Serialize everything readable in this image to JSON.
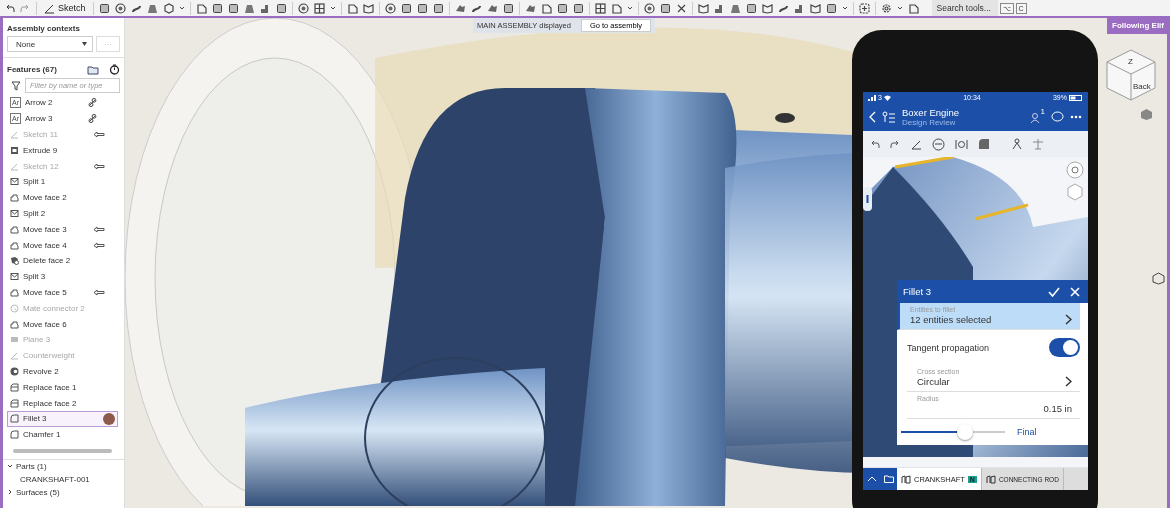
{
  "toolbar": {
    "sketch_label": "Sketch",
    "search": {
      "placeholder": "Search tools...",
      "keys": [
        "⌥",
        "C"
      ]
    }
  },
  "viewport": {
    "banner": {
      "message": "MAIN ASSEMBLY displayed",
      "button": "Go to assembly"
    },
    "following_label": "Following Elif",
    "view_cube": {
      "faces": [
        "Z",
        "Back"
      ]
    }
  },
  "sidebar": {
    "contexts_title": "Assembly contexts",
    "context_select": "None",
    "more_button": "···",
    "features_title": "Features (67)",
    "filter": {
      "placeholder": "Filter by name or type"
    },
    "features": [
      {
        "label": "Arrow 2",
        "kind": "arrow-text",
        "icon_text": "Ar",
        "linked": true,
        "arrow_marker": false,
        "disabled": false,
        "selected": false,
        "collaborator": false
      },
      {
        "label": "Arrow 3",
        "kind": "arrow-text",
        "icon_text": "Ar",
        "linked": true,
        "arrow_marker": false,
        "disabled": false,
        "selected": false,
        "collaborator": false
      },
      {
        "label": "Sketch 11",
        "kind": "sketch",
        "linked": false,
        "arrow_marker": true,
        "disabled": true,
        "selected": false,
        "collaborator": false
      },
      {
        "label": "Extrude 9",
        "kind": "extrude",
        "disabled": false,
        "selected": false,
        "collaborator": false
      },
      {
        "label": "Sketch 12",
        "kind": "sketch",
        "linked": false,
        "arrow_marker": true,
        "disabled": true,
        "selected": false,
        "collaborator": false
      },
      {
        "label": "Split 1",
        "kind": "split",
        "disabled": false,
        "selected": false,
        "collaborator": false
      },
      {
        "label": "Move face 2",
        "kind": "move-face",
        "disabled": false,
        "selected": false,
        "collaborator": false
      },
      {
        "label": "Split 2",
        "kind": "split",
        "disabled": false,
        "selected": false,
        "collaborator": false
      },
      {
        "label": "Move face 3",
        "kind": "move-face",
        "linked": false,
        "arrow_marker": true,
        "disabled": false,
        "selected": false,
        "collaborator": false
      },
      {
        "label": "Move face 4",
        "kind": "move-face",
        "linked": false,
        "arrow_marker": true,
        "disabled": false,
        "selected": false,
        "collaborator": false
      },
      {
        "label": "Delete face 2",
        "kind": "delete-face",
        "disabled": false,
        "selected": false,
        "collaborator": false
      },
      {
        "label": "Split 3",
        "kind": "split",
        "disabled": false,
        "selected": false,
        "collaborator": false
      },
      {
        "label": "Move face 5",
        "kind": "move-face",
        "linked": false,
        "arrow_marker": true,
        "disabled": false,
        "selected": false,
        "collaborator": false
      },
      {
        "label": "Mate connector 2",
        "kind": "mate-connector",
        "disabled": true,
        "selected": false,
        "collaborator": false
      },
      {
        "label": "Move face 6",
        "kind": "move-face",
        "disabled": false,
        "selected": false,
        "collaborator": false
      },
      {
        "label": "Plane 3",
        "kind": "plane",
        "disabled": true,
        "selected": false,
        "collaborator": false
      },
      {
        "label": "Counterweight",
        "kind": "sketch",
        "disabled": true,
        "selected": false,
        "collaborator": false
      },
      {
        "label": "Revolve 2",
        "kind": "revolve",
        "disabled": false,
        "selected": false,
        "collaborator": false
      },
      {
        "label": "Replace face 1",
        "kind": "replace-face",
        "disabled": false,
        "selected": false,
        "collaborator": false
      },
      {
        "label": "Replace face 2",
        "kind": "replace-face",
        "disabled": false,
        "selected": false,
        "collaborator": false
      },
      {
        "label": "Fillet 3",
        "kind": "fillet",
        "disabled": false,
        "selected": true,
        "collaborator": true
      },
      {
        "label": "Chamfer 1",
        "kind": "fillet",
        "disabled": false,
        "selected": false,
        "collaborator": false
      }
    ],
    "groups": [
      {
        "label": "Parts (1)",
        "expanded": true,
        "children": [
          "CRANKSHAFT-001"
        ]
      },
      {
        "label": "Surfaces (5)",
        "expanded": false
      }
    ]
  },
  "phone": {
    "status": {
      "carrier": "3",
      "time": "10:34",
      "battery": "39%"
    },
    "header": {
      "title": "Boxer Engine",
      "subtitle": "Design Review",
      "notification_count": "1"
    },
    "dialog": {
      "title": "Fillet 3",
      "entities": {
        "label": "Entities to fillet",
        "value": "12 entities selected"
      },
      "tangent": {
        "label": "Tangent propagation",
        "on": true
      },
      "cross_section": {
        "label": "Cross section",
        "value": "Circular"
      },
      "radius": {
        "label": "Radius",
        "value": "0.15 in"
      },
      "slider": {
        "level": 0.62,
        "label": "Final"
      }
    },
    "tabs": [
      {
        "label": "CRANKSHAFT",
        "badge": "N",
        "selected": true
      },
      {
        "label": "CONNECTING ROD",
        "selected": false
      }
    ]
  }
}
